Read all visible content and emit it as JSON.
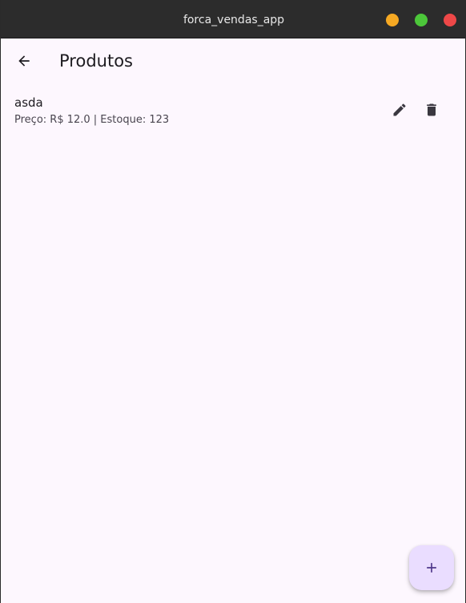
{
  "window": {
    "title": "forca_vendas_app"
  },
  "appbar": {
    "back_icon": "arrow-back-icon",
    "title": "Produtos"
  },
  "products": [
    {
      "name": "asda",
      "details": "Preço: R$ 12.0 | Estoque: 123",
      "edit_icon": "pencil-icon",
      "delete_icon": "trash-icon"
    }
  ],
  "fab": {
    "icon": "plus-icon"
  },
  "colors": {
    "titlebar": "#2c2c2c",
    "background": "#fdf7fe",
    "fab": "#eaddff",
    "minimize": "#f6a923",
    "maximize": "#4cc73a",
    "close": "#ee4848"
  }
}
